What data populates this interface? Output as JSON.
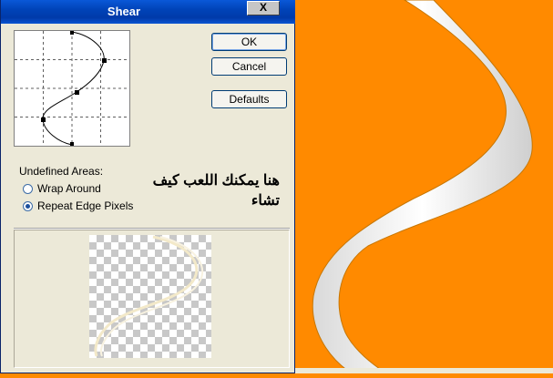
{
  "window": {
    "title": "Shear",
    "close_label": "X"
  },
  "buttons": {
    "ok": "OK",
    "cancel": "Cancel",
    "defaults": "Defaults"
  },
  "undefined_areas": {
    "heading": "Undefined Areas:",
    "options": [
      {
        "label": "Wrap Around",
        "selected": false
      },
      {
        "label": "Repeat Edge Pixels",
        "selected": true
      }
    ]
  },
  "annotation": {
    "line1": "هنا يمكنك اللعب كيف",
    "line2": "تشاء"
  },
  "colors": {
    "canvas_orange": "#ff8a00",
    "titlebar_blue": "#0043b8",
    "dialog_bg": "#ece9d8"
  },
  "icons": {
    "close": "close-icon",
    "radio": "radio-button-icon"
  }
}
